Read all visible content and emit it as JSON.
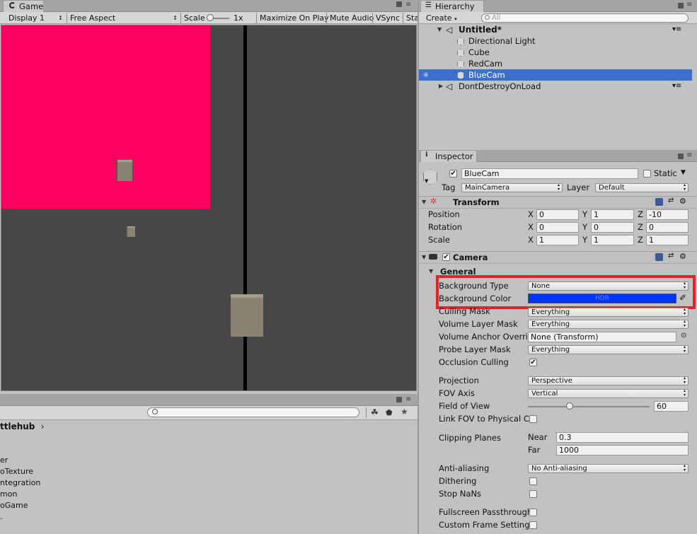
{
  "game": {
    "tab": "Game",
    "display": "Display 1",
    "aspect": "Free Aspect",
    "scale_label": "Scale",
    "scale_value": "1x",
    "maximize": "Maximize On Play",
    "mute": "Mute Audio",
    "vsync": "VSync",
    "stats": "Stats",
    "colors": {
      "red_view": "#ff0060",
      "background": "#474747",
      "divider": "#000000",
      "cube": "#8a8372"
    }
  },
  "hierarchy": {
    "tab": "Hierarchy",
    "create": "Create",
    "search_placeholder": "All",
    "scene": "Untitled*",
    "items": [
      "Directional Light",
      "Cube",
      "RedCam",
      "BlueCam"
    ],
    "dont_destroy": "DontDestroyOnLoad"
  },
  "inspector": {
    "tab": "Inspector",
    "object_name": "BlueCam",
    "static": "Static",
    "tag_label": "Tag",
    "tag_value": "MainCamera",
    "layer_label": "Layer",
    "layer_value": "Default",
    "transform": {
      "title": "Transform",
      "position": {
        "label": "Position",
        "x": "0",
        "y": "1",
        "z": "-10"
      },
      "rotation": {
        "label": "Rotation",
        "x": "0",
        "y": "0",
        "z": "0"
      },
      "scale": {
        "label": "Scale",
        "x": "1",
        "y": "1",
        "z": "1"
      }
    },
    "camera": {
      "title": "Camera",
      "general": "General",
      "background_type": {
        "label": "Background Type",
        "value": "None"
      },
      "background_color": {
        "label": "Background Color",
        "hdr": "HDR",
        "color": "#0033ff"
      },
      "culling_mask": {
        "label": "Culling Mask",
        "value": "Everything"
      },
      "volume_layer_mask": {
        "label": "Volume Layer Mask",
        "value": "Everything"
      },
      "volume_anchor": {
        "label": "Volume Anchor Overri",
        "value": "None (Transform)"
      },
      "probe_layer_mask": {
        "label": "Probe Layer Mask",
        "value": "Everything"
      },
      "occlusion_culling": {
        "label": "Occlusion Culling",
        "checked": true
      },
      "projection": {
        "label": "Projection",
        "value": "Perspective"
      },
      "fov_axis": {
        "label": "FOV Axis",
        "value": "Vertical"
      },
      "field_of_view": {
        "label": "Field of View",
        "value": "60",
        "slider_fraction": 0.33
      },
      "link_fov": {
        "label": "Link FOV to Physical C"
      },
      "clipping": {
        "label": "Clipping Planes",
        "near_label": "Near",
        "near": "0.3",
        "far_label": "Far",
        "far": "1000"
      },
      "anti_aliasing": {
        "label": "Anti-aliasing",
        "value": "No Anti-aliasing"
      },
      "dithering": {
        "label": "Dithering"
      },
      "stop_nans": {
        "label": "Stop NaNs"
      },
      "fullscreen_passthrough": {
        "label": "Fullscreen Passthrough"
      },
      "custom_frame_settings": {
        "label": "Custom Frame Setting"
      }
    },
    "highlight_color": "#e8202a"
  },
  "project": {
    "breadcrumb": "ttlehub",
    "items": [
      "er",
      "oTexture",
      "ntegration",
      "mon",
      "oGame",
      "."
    ]
  }
}
